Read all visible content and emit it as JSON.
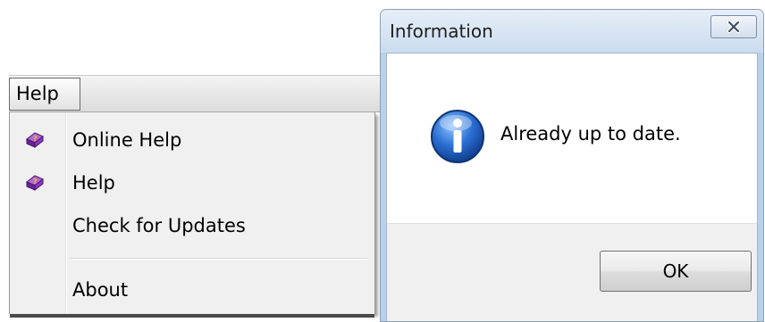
{
  "menu": {
    "title": "Help",
    "items": [
      {
        "label": "Online Help",
        "icon": "help-book-icon"
      },
      {
        "label": "Help",
        "icon": "help-book-icon"
      },
      {
        "label": "Check for Updates",
        "icon": ""
      },
      {
        "label": "About",
        "icon": ""
      }
    ]
  },
  "dialog": {
    "title": "Information",
    "message": "Already up to date.",
    "icon": "info-icon",
    "ok_label": "OK",
    "close_icon": "close-icon"
  },
  "colors": {
    "dialog_frame": "#b9d1ea",
    "info_icon_blue": "#1f5fbf",
    "book_purple": "#7b2fb0",
    "book_question_yellow": "#f2c200"
  }
}
